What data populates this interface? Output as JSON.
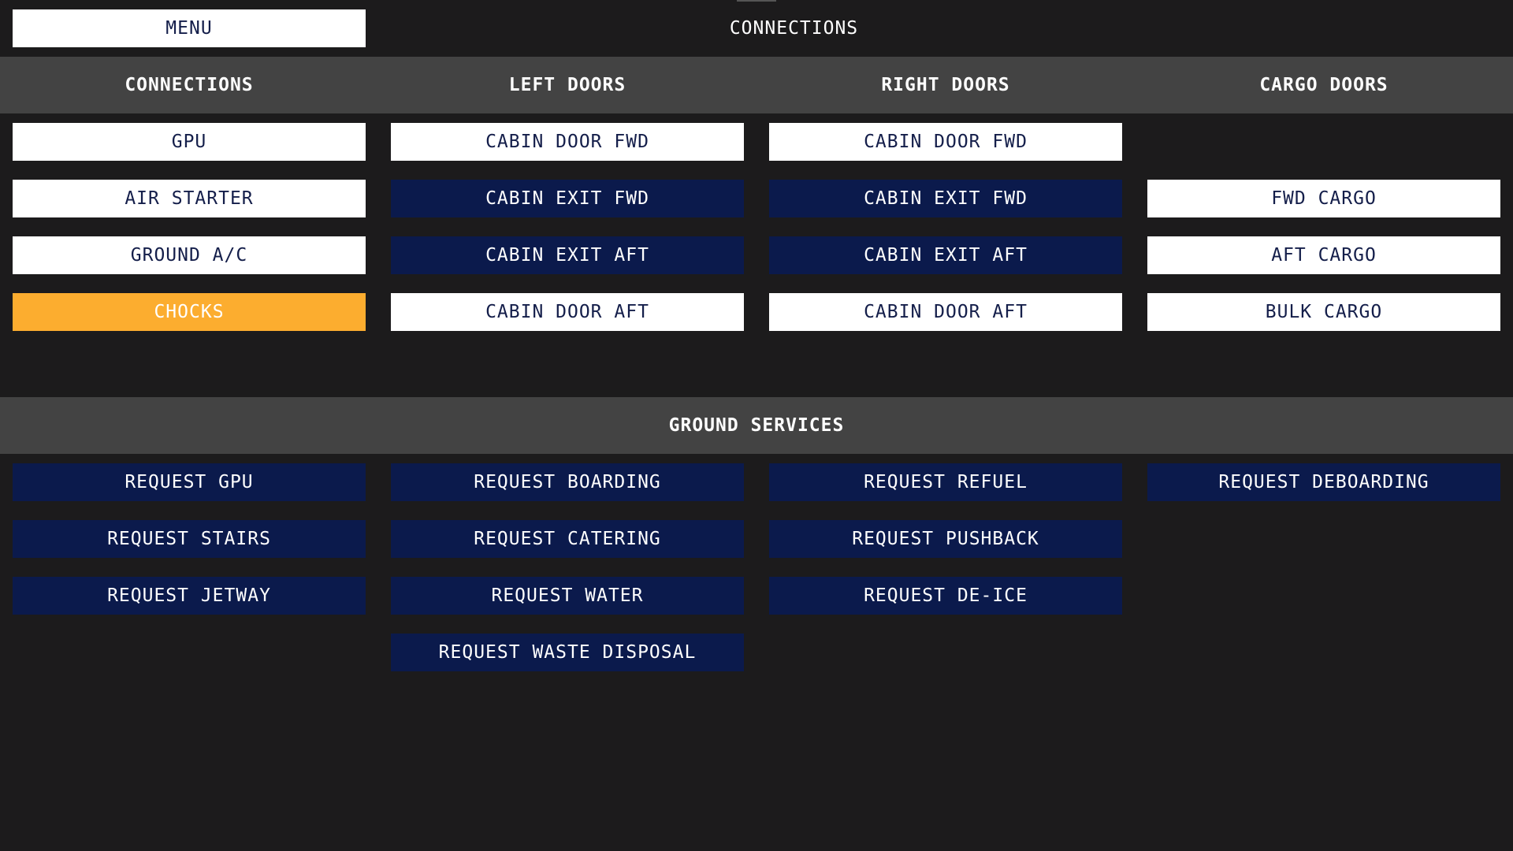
{
  "header": {
    "menu_label": "MENU",
    "title": "CONNECTIONS"
  },
  "sections": {
    "connections": {
      "heading": "CONNECTIONS",
      "items": [
        "GPU",
        "AIR STARTER",
        "GROUND A/C",
        "CHOCKS"
      ]
    },
    "left_doors": {
      "heading": "LEFT DOORS",
      "items": [
        "CABIN DOOR FWD",
        "CABIN EXIT FWD",
        "CABIN EXIT AFT",
        "CABIN DOOR AFT"
      ]
    },
    "right_doors": {
      "heading": "RIGHT DOORS",
      "items": [
        "CABIN DOOR FWD",
        "CABIN EXIT FWD",
        "CABIN EXIT AFT",
        "CABIN DOOR AFT"
      ]
    },
    "cargo_doors": {
      "heading": "CARGO DOORS",
      "items": [
        "FWD CARGO",
        "AFT CARGO",
        "BULK CARGO"
      ]
    }
  },
  "ground_services": {
    "heading": "GROUND SERVICES",
    "col1": [
      "REQUEST GPU",
      "REQUEST STAIRS",
      "REQUEST JETWAY"
    ],
    "col2": [
      "REQUEST BOARDING",
      "REQUEST CATERING",
      "REQUEST WATER",
      "REQUEST WASTE DISPOSAL"
    ],
    "col3": [
      "REQUEST REFUEL",
      "REQUEST PUSHBACK",
      "REQUEST DE-ICE"
    ],
    "col4": [
      "REQUEST DEBOARDING"
    ]
  },
  "colors": {
    "background": "#1c1b1c",
    "band": "#434343",
    "button_inactive": "#ffffff",
    "button_navy": "#0b1a4c",
    "button_active": "#fcad2f"
  },
  "states": {
    "chocks_active": true
  }
}
